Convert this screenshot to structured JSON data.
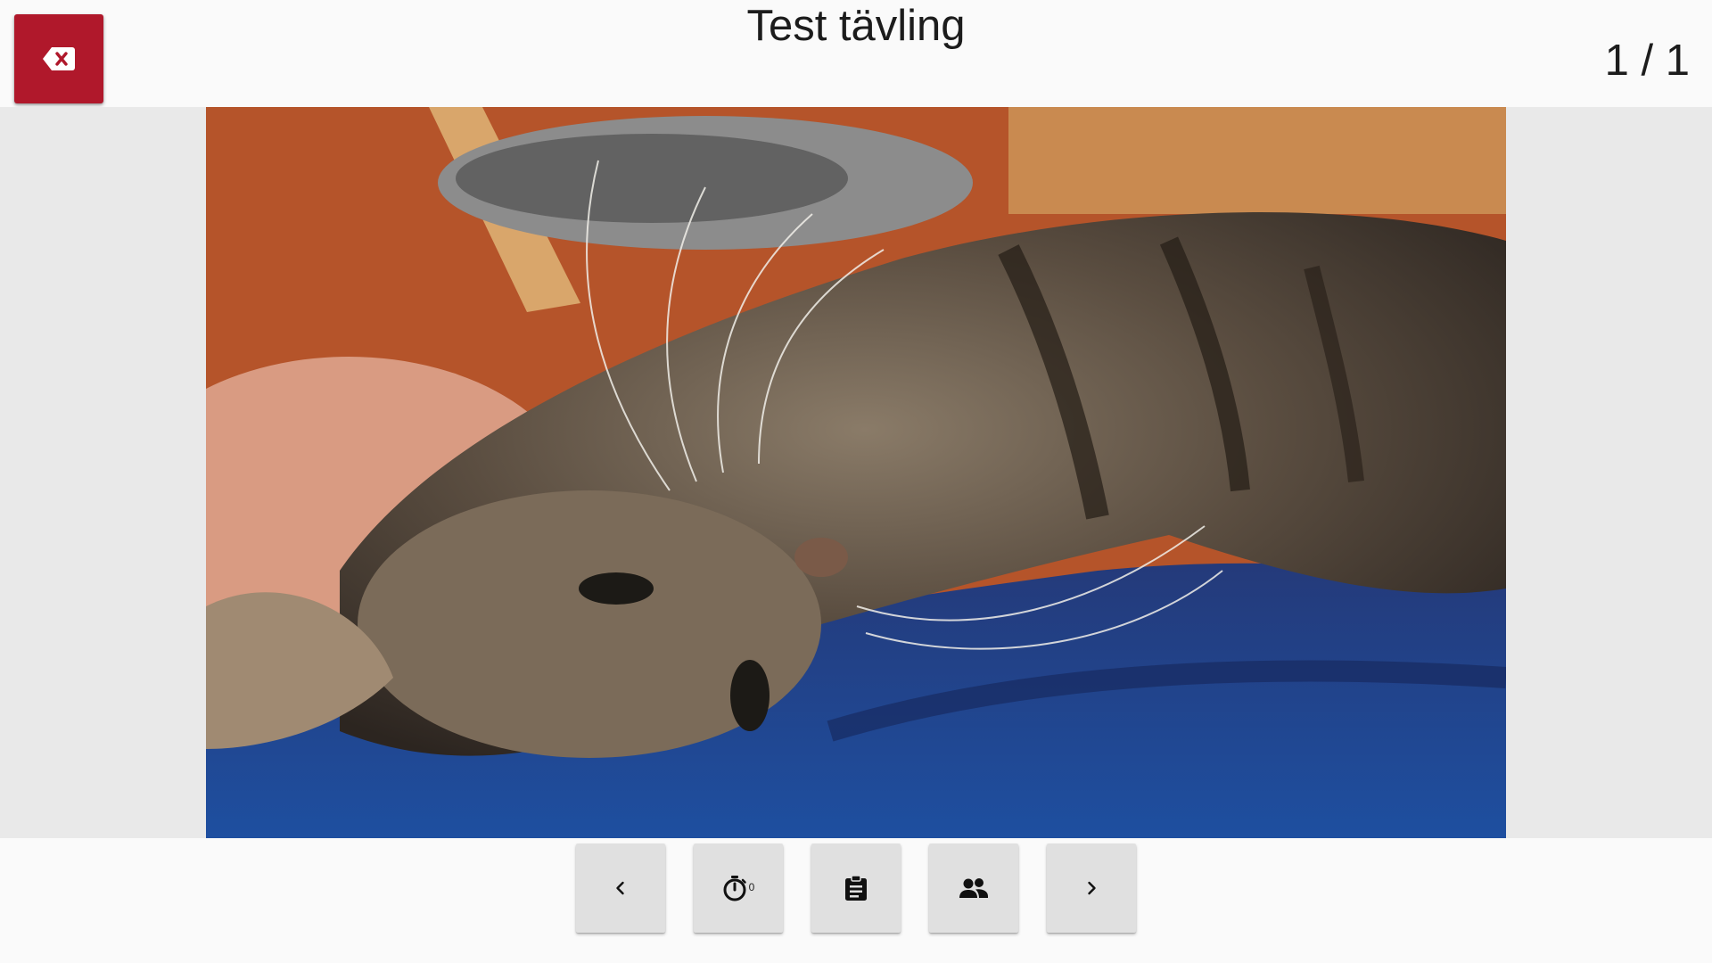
{
  "header": {
    "title": "Test tävling",
    "counter": "1 / 1",
    "close_icon": "backspace-icon",
    "close_color": "#b0182b"
  },
  "slide": {
    "image": "photo of a tabby cat lying on blue fabric"
  },
  "controls": {
    "prev_icon": "chevron-left-icon",
    "timer_icon": "timer-icon",
    "timer_value": "0",
    "notes_icon": "clipboard-icon",
    "teams_icon": "people-icon",
    "next_icon": "chevron-right-icon"
  }
}
